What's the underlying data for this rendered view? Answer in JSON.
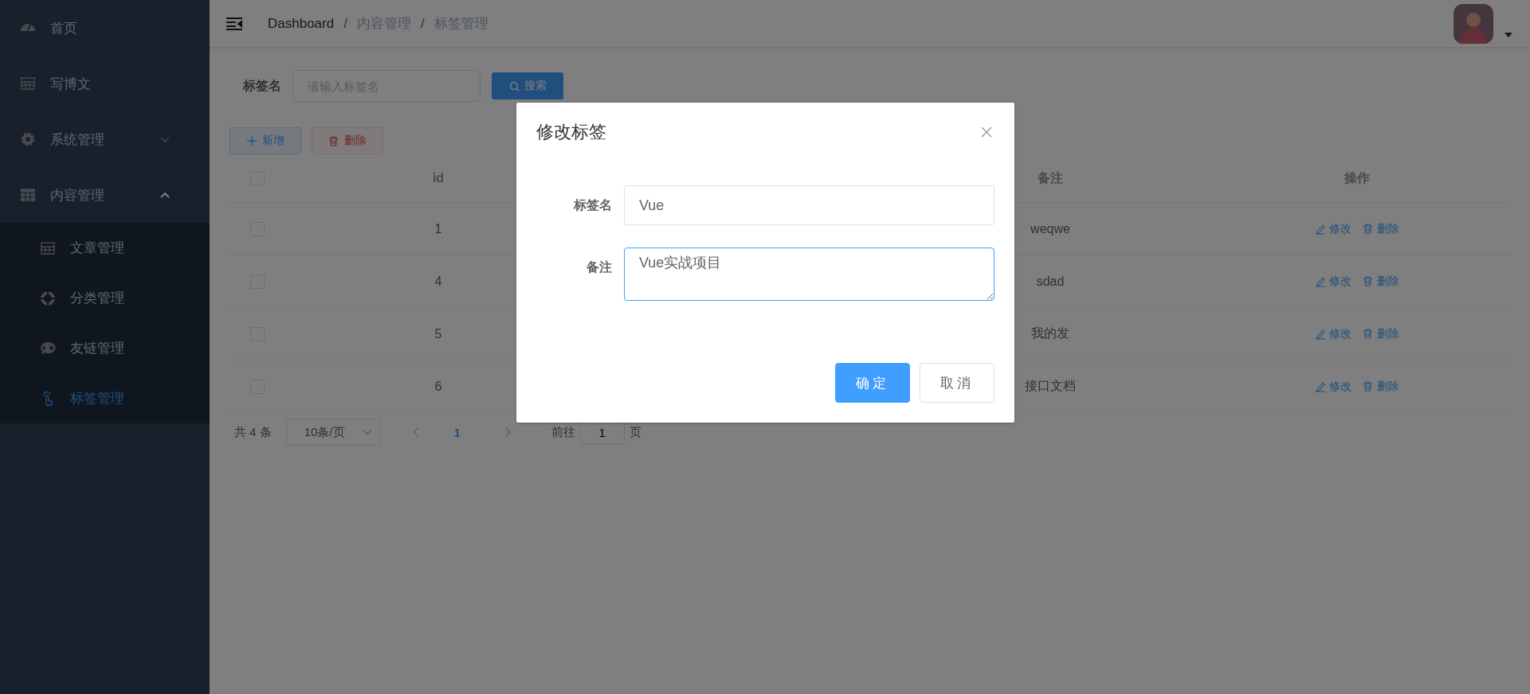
{
  "sidebar": {
    "items": [
      {
        "label": "首页",
        "selected": false
      },
      {
        "label": "写博文",
        "selected": false
      },
      {
        "label": "系统管理",
        "selected": false,
        "expanded": false
      },
      {
        "label": "内容管理",
        "selected": false,
        "expanded": true,
        "children": [
          {
            "label": "文章管理",
            "selected": false
          },
          {
            "label": "分类管理",
            "selected": false
          },
          {
            "label": "友链管理",
            "selected": false
          },
          {
            "label": "标签管理",
            "selected": true
          }
        ]
      }
    ]
  },
  "header": {
    "breadcrumb": [
      {
        "label": "Dashboard"
      },
      {
        "separator": "/",
        "label": "内容管理"
      },
      {
        "separator": "/",
        "label": "标签管理"
      }
    ]
  },
  "search": {
    "label": "标签名",
    "placeholder": "请输入标签名",
    "button": "搜索"
  },
  "toolbar": [
    {
      "label": "新增",
      "kind": "add",
      "disabled": false
    },
    {
      "label": "删除",
      "kind": "delete",
      "disabled": true
    }
  ],
  "table": {
    "header_checked": false,
    "columns": [
      "id",
      "备注",
      "操作"
    ],
    "rows": [
      {
        "checked": false,
        "id": "1",
        "remark": "weqwe",
        "actions": [
          "修改",
          "删除"
        ]
      },
      {
        "checked": false,
        "id": "4",
        "remark": "sdad",
        "actions": [
          "修改",
          "删除"
        ]
      },
      {
        "checked": false,
        "id": "5",
        "remark": "我的发",
        "actions": [
          "修改",
          "删除"
        ]
      },
      {
        "checked": false,
        "id": "6",
        "remark": "接口文档",
        "actions": [
          "修改",
          "删除"
        ]
      }
    ]
  },
  "pagination": {
    "total": "共 4 条",
    "page_size": "10条/页",
    "pages": [
      {
        "label": "1",
        "selected": true
      }
    ],
    "goto_label": "前往",
    "goto_value": "1",
    "goto_suffix": "页"
  },
  "dialog": {
    "title": "修改标签",
    "fields": [
      {
        "kind": "input",
        "label": "标签名",
        "value": "Vue",
        "focused": false
      },
      {
        "kind": "textarea",
        "label": "备注",
        "value": "Vue实战项目",
        "focused": true
      }
    ],
    "buttons": [
      {
        "label": "确定",
        "primary": true
      },
      {
        "label": "取消",
        "primary": false
      }
    ]
  }
}
